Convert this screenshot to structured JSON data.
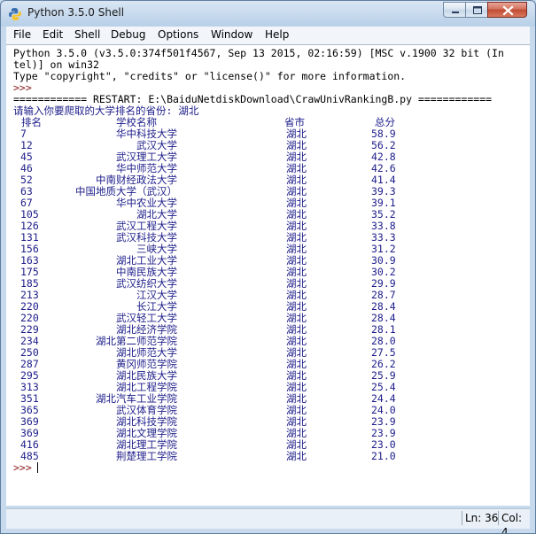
{
  "window": {
    "title": "Python 3.5.0 Shell"
  },
  "menu": [
    "File",
    "Edit",
    "Shell",
    "Debug",
    "Options",
    "Window",
    "Help"
  ],
  "shell": {
    "banner_1": "Python 3.5.0 (v3.5.0:374f501f4567, Sep 13 2015, 02:16:59) [MSC v.1900 32 bit (In",
    "banner_2": "tel)] on win32",
    "banner_3": "Type \"copyright\", \"credits\" or \"license()\" for more information.",
    "prompt_1": ">>> ",
    "restart": "============ RESTART: E:\\BaiduNetdiskDownload\\CrawUnivRankingB.py ============",
    "input_prompt": "请输入你要爬取的大学排名的省份: 湖北",
    "headers": [
      "排名",
      "学校名称",
      "省市",
      "总分"
    ],
    "rows": [
      [
        "7",
        "华中科技大学",
        "湖北",
        "58.9"
      ],
      [
        "12",
        "武汉大学",
        "湖北",
        "56.2"
      ],
      [
        "45",
        "武汉理工大学",
        "湖北",
        "42.8"
      ],
      [
        "46",
        "华中师范大学",
        "湖北",
        "42.6"
      ],
      [
        "52",
        "中南财经政法大学",
        "湖北",
        "41.4"
      ],
      [
        "63",
        "中国地质大学（武汉）",
        "湖北",
        "39.3"
      ],
      [
        "67",
        "华中农业大学",
        "湖北",
        "39.1"
      ],
      [
        "105",
        "湖北大学",
        "湖北",
        "35.2"
      ],
      [
        "126",
        "武汉工程大学",
        "湖北",
        "33.8"
      ],
      [
        "131",
        "武汉科技大学",
        "湖北",
        "33.3"
      ],
      [
        "156",
        "三峡大学",
        "湖北",
        "31.2"
      ],
      [
        "163",
        "湖北工业大学",
        "湖北",
        "30.9"
      ],
      [
        "175",
        "中南民族大学",
        "湖北",
        "30.2"
      ],
      [
        "185",
        "武汉纺织大学",
        "湖北",
        "29.9"
      ],
      [
        "213",
        "江汉大学",
        "湖北",
        "28.7"
      ],
      [
        "220",
        "长江大学",
        "湖北",
        "28.4"
      ],
      [
        "220",
        "武汉轻工大学",
        "湖北",
        "28.4"
      ],
      [
        "229",
        "湖北经济学院",
        "湖北",
        "28.1"
      ],
      [
        "234",
        "湖北第二师范学院",
        "湖北",
        "28.0"
      ],
      [
        "250",
        "湖北师范大学",
        "湖北",
        "27.5"
      ],
      [
        "287",
        "黄冈师范学院",
        "湖北",
        "26.2"
      ],
      [
        "295",
        "湖北民族大学",
        "湖北",
        "25.9"
      ],
      [
        "313",
        "湖北工程学院",
        "湖北",
        "25.4"
      ],
      [
        "351",
        "湖北汽车工业学院",
        "湖北",
        "24.4"
      ],
      [
        "365",
        "武汉体育学院",
        "湖北",
        "24.0"
      ],
      [
        "369",
        "湖北科技学院",
        "湖北",
        "23.9"
      ],
      [
        "369",
        "湖北文理学院",
        "湖北",
        "23.9"
      ],
      [
        "416",
        "湖北理工学院",
        "湖北",
        "23.0"
      ],
      [
        "485",
        "荆楚理工学院",
        "湖北",
        "21.0"
      ]
    ],
    "prompt_2": ">>> "
  },
  "status": {
    "line": "Ln: 36",
    "col": "Col: 4"
  },
  "colors": {
    "output": "#1c1c8a",
    "prompt": "#8a1a1a",
    "close": "#c04a33"
  }
}
